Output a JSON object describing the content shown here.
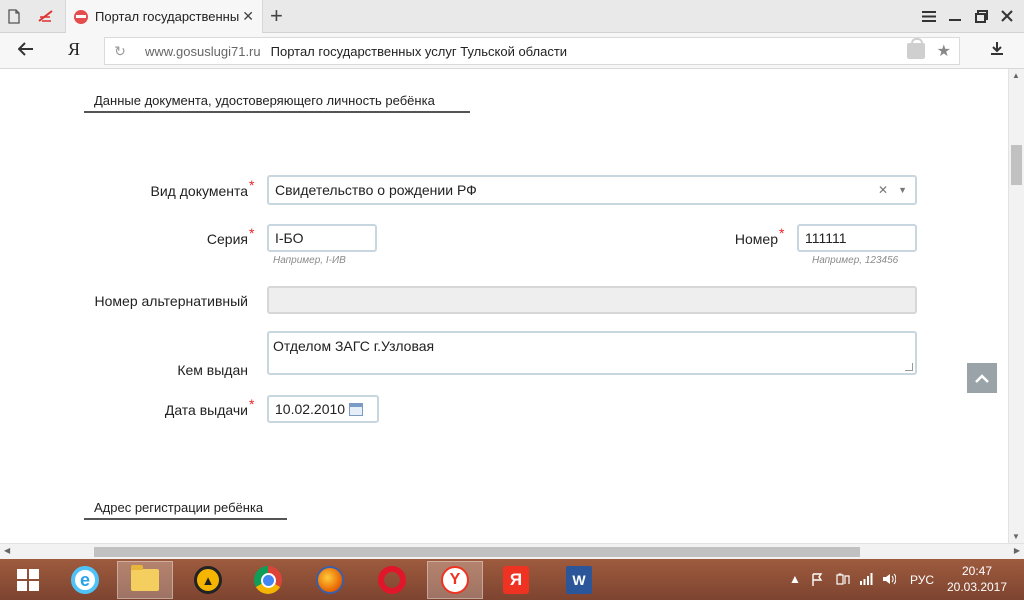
{
  "browser": {
    "tab_title": "Портал государственны",
    "tab_close": "✕",
    "new_tab": "+",
    "domain": "www.gosuslugi71.ru",
    "page_title": "Портал государственных услуг Тульской области",
    "yandex_label": "Я"
  },
  "form": {
    "section_document": "Данные документа, удостоверяющего личность ребёнка",
    "section_address": "Адрес регистрации ребёнка",
    "required_mark": "*",
    "doc_type": {
      "label": "Вид документа",
      "value": "Свидетельство о рождении РФ",
      "clear": "✕",
      "arrow": "▼"
    },
    "series": {
      "label": "Серия",
      "value": "I-БО",
      "hint": "Например, I-ИВ"
    },
    "number": {
      "label": "Номер",
      "value": "111111",
      "hint": "Например, 123456"
    },
    "alt_number": {
      "label": "Номер альтернативный",
      "value": ""
    },
    "issued_by": {
      "label": "Кем выдан",
      "value": "Отделом ЗАГС г.Узловая"
    },
    "issue_date": {
      "label": "Дата выдачи",
      "value": "10.02.2010"
    }
  },
  "taskbar": {
    "language": "РУС",
    "time": "20:47",
    "date": "20.03.2017"
  },
  "colors": {
    "required": "#ee2222",
    "field_border": "#c8d6e0",
    "taskbar": "#8a4c35"
  }
}
